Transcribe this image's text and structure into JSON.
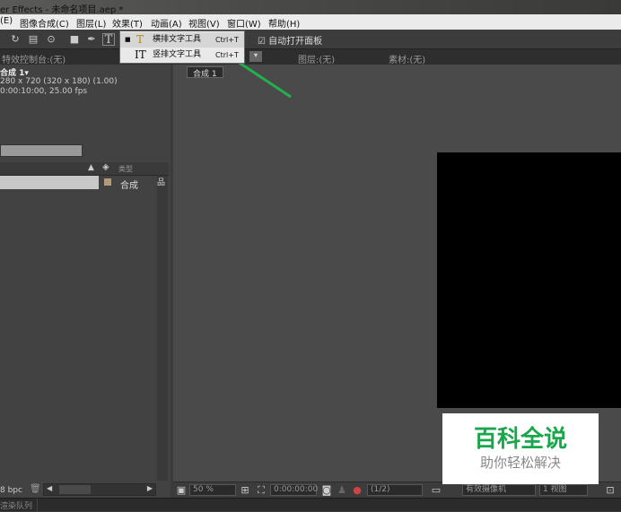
{
  "title": "er Effects - 未命名项目.aep *",
  "menu": [
    "(E)",
    "图像合成(C)",
    "图层(L)",
    "效果(T)",
    "动画(A)",
    "视图(V)",
    "窗口(W)",
    "帮助(H)"
  ],
  "toolbar": {
    "auto_open_panel": "自动打开面板"
  },
  "dropdown": [
    {
      "icon": "T",
      "label": "横排文字工具",
      "shortcut": "Ctrl+T"
    },
    {
      "icon": "IT",
      "label": "竖排文字工具",
      "shortcut": "Ctrl+T"
    }
  ],
  "tabs": {
    "effects": "特效控制台:(无)",
    "layer": "图层:(无)",
    "footage": "素材:(无)"
  },
  "project": {
    "comp_name": "合成 1▾",
    "dims": "280 x 720  (320 x 180) (1.00)",
    "duration": "0:00:10:00, 25.00 fps",
    "type_header": "类型",
    "row_type": "合成",
    "bpc": "8 bpc"
  },
  "comp": {
    "tab": "合成 1",
    "zoom": "50 %",
    "timecode": "0:00:00:00",
    "resolution": "(1/2)",
    "camera": "有效摄像机",
    "views": "1 视图"
  },
  "watermark": {
    "line1": "百科全说",
    "line2": "助你轻松解决"
  },
  "status": {
    "render_queue": "渲染队列"
  },
  "colors": {
    "accent": "#1aa64a",
    "arrow": "#22b14c"
  }
}
